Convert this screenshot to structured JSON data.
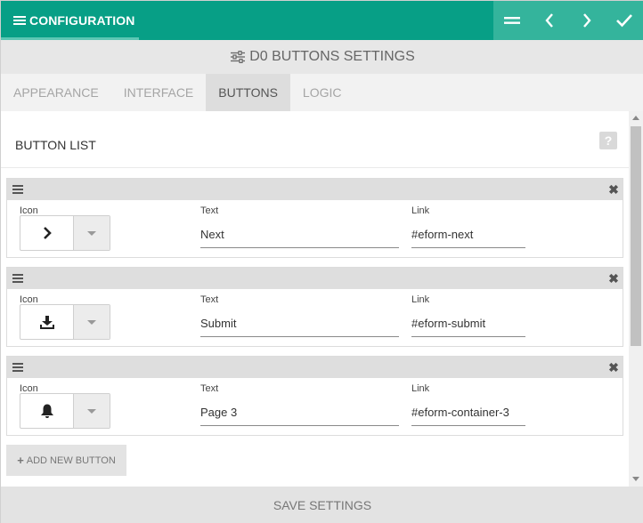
{
  "header": {
    "title": "CONFIGURATION",
    "icons": [
      "list-icon",
      "collapse-icon",
      "chevron-left-icon",
      "chevron-right-icon",
      "check-icon"
    ],
    "colors": {
      "primary": "#079f86",
      "secondary": "#34b49c"
    }
  },
  "subheader": {
    "title": "D0 BUTTONS SETTINGS",
    "icon": "sliders-icon"
  },
  "tabs": [
    {
      "label": "APPEARANCE",
      "active": false
    },
    {
      "label": "INTERFACE",
      "active": false
    },
    {
      "label": "BUTTONS",
      "active": true
    },
    {
      "label": "LOGIC",
      "active": false
    }
  ],
  "section": {
    "title": "BUTTON LIST",
    "help": "?"
  },
  "fields": {
    "icon_label": "Icon",
    "text_label": "Text",
    "link_label": "Link"
  },
  "buttons": [
    {
      "icon": "chevron-right-icon",
      "text": "Next",
      "link": "#eform-next"
    },
    {
      "icon": "download-icon",
      "text": "Submit",
      "link": "#eform-submit"
    },
    {
      "icon": "bell-icon",
      "text": "Page 3",
      "link": "#eform-container-3"
    }
  ],
  "add_button": {
    "label": "ADD NEW BUTTON"
  },
  "footer": {
    "save_label": "SAVE SETTINGS"
  }
}
